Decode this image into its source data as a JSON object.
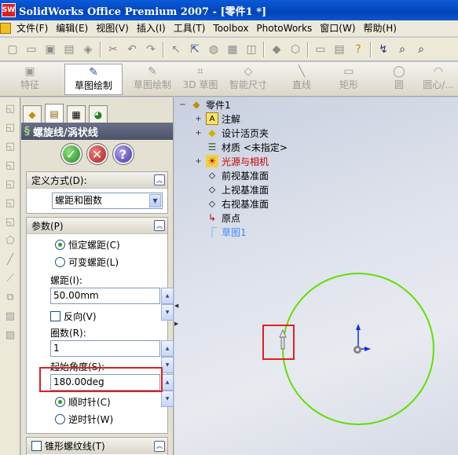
{
  "titlebar": {
    "logo": "SW",
    "title": "SolidWorks Office Premium 2007 - [零件1 *]"
  },
  "menubar": [
    "文件(F)",
    "编辑(E)",
    "视图(V)",
    "插入(I)",
    "工具(T)",
    "Toolbox",
    "PhotoWorks",
    "窗口(W)",
    "帮助(H)"
  ],
  "toolbar": {
    "buttons": [
      "new-icon",
      "open-icon",
      "save-icon",
      "print-icon",
      "rebuild-icon",
      "cut-icon",
      "undo-icon",
      "redo-icon",
      "select-icon",
      "filter-icon",
      "light-icon",
      "grid-icon",
      "pattern-icon",
      "view-icon",
      "display-icon",
      "screen-icon",
      "options-icon",
      "help-icon",
      "flip-icon",
      "zoom-icon",
      "zoom-area-icon"
    ]
  },
  "command_manager": {
    "items": [
      {
        "label": "特征",
        "icon": "feature-icon",
        "active": false
      },
      {
        "label": "草图绘制",
        "icon": "sketch-icon",
        "active": true
      },
      {
        "label": "草图绘制",
        "icon": "sketch-disabled-icon",
        "active": false
      },
      {
        "label": "3D 草图",
        "icon": "3d-sketch-icon",
        "active": false
      },
      {
        "label": "智能尺寸",
        "icon": "smart-dimension-icon",
        "active": false
      },
      {
        "label": "直线",
        "icon": "line-icon",
        "active": false
      },
      {
        "label": "矩形",
        "icon": "rectangle-icon",
        "active": false
      },
      {
        "label": "圆",
        "icon": "circle-icon",
        "active": false
      },
      {
        "label": "圆心/...",
        "icon": "arc-icon",
        "active": false
      }
    ]
  },
  "property_manager": {
    "title": "螺旋线/涡状线",
    "define_group": {
      "title": "定义方式(D):",
      "selected": "螺距和圈数"
    },
    "params_group": {
      "title": "参数(P)",
      "pitch_type": {
        "constant": "恒定螺距(C)",
        "variable": "可变螺距(L)",
        "selected": "constant"
      },
      "pitch_label": "螺距(I):",
      "pitch_value": "50.00mm",
      "reverse_label": "反向(V)",
      "reverse_checked": false,
      "revolutions_label": "圈数(R):",
      "revolutions_value": "1",
      "start_angle_label": "起始角度(S):",
      "start_angle_value": "180.00deg",
      "clockwise_label": "顺时针(C)",
      "counterclockwise_label": "逆时针(W)",
      "direction_selected": "clockwise"
    },
    "taper_group": {
      "title": "锥形螺纹线(T)",
      "checked": false
    }
  },
  "feature_tree": {
    "root": "零件1",
    "items": [
      {
        "label": "注解",
        "icon": "annotation-icon",
        "expandable": true
      },
      {
        "label": "设计活页夹",
        "icon": "design-binder-icon",
        "expandable": true
      },
      {
        "label": "材质 <未指定>",
        "icon": "material-icon",
        "expandable": false
      },
      {
        "label": "光源与相机",
        "icon": "lights-cameras-icon",
        "expandable": true,
        "color": "#c80000"
      },
      {
        "label": "前视基准面",
        "icon": "plane-icon",
        "expandable": false
      },
      {
        "label": "上视基准面",
        "icon": "plane-icon",
        "expandable": false
      },
      {
        "label": "右视基准面",
        "icon": "plane-icon",
        "expandable": false
      },
      {
        "label": "原点",
        "icon": "origin-icon",
        "expandable": false
      },
      {
        "label": "草图1",
        "icon": "sketch-icon",
        "expandable": false,
        "color": "#3c8cff"
      }
    ]
  },
  "colors": {
    "circle": "#60e000",
    "highlight_box": "#e02020",
    "axis": "#1030e0"
  }
}
